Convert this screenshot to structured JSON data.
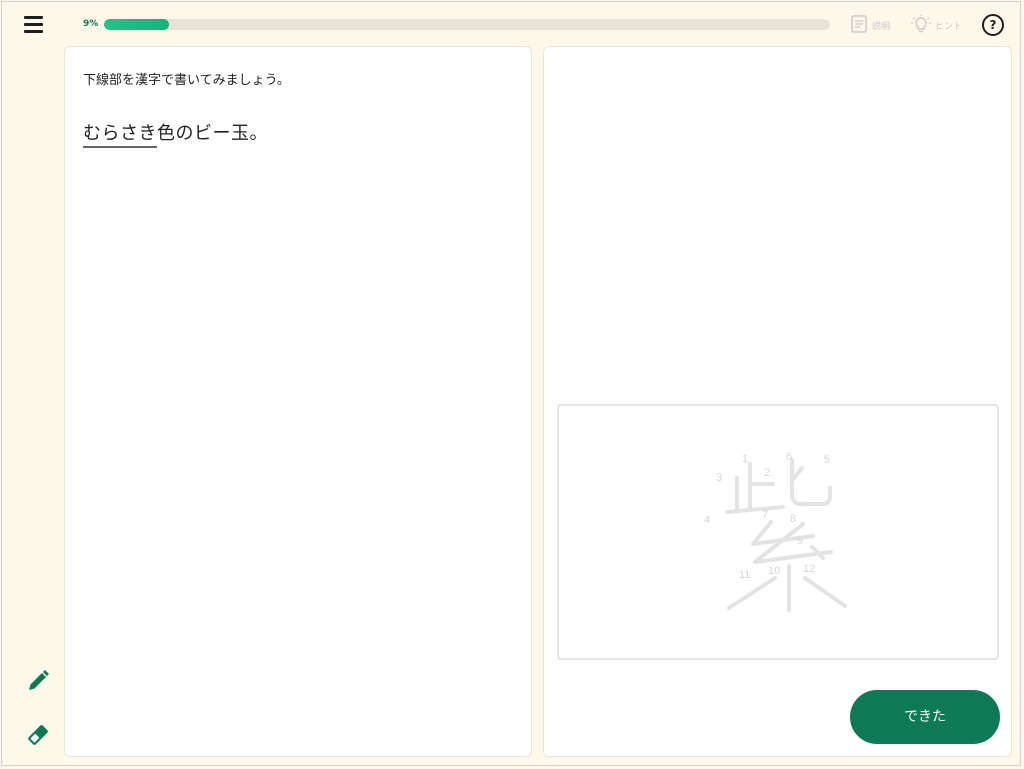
{
  "header": {
    "menu_icon": "hamburger-menu-icon",
    "progress_label": "9%",
    "progress_fraction": 0.09,
    "explain_label": "説明",
    "explain_icon": "document-icon",
    "hint_label": "ヒント",
    "hint_icon": "lightbulb-icon",
    "help_icon": "question-circle-icon",
    "help_glyph": "?"
  },
  "question": {
    "instruction": "下線部を漢字で書いてみましょう。",
    "underlined_text": "むらさき",
    "rest_text": "色のビー玉。"
  },
  "writing": {
    "guide_character": "紫",
    "stroke_numbers": [
      "1",
      "2",
      "3",
      "4",
      "5",
      "6",
      "7",
      "8",
      "9",
      "10",
      "11",
      "12"
    ]
  },
  "actions": {
    "done_label": "できた"
  },
  "tools": {
    "pencil_icon": "pencil-icon",
    "eraser_icon": "eraser-icon"
  },
  "colors": {
    "accent": "#0d7a55",
    "progress": "#1ebf86",
    "background": "#fdf8ea"
  }
}
